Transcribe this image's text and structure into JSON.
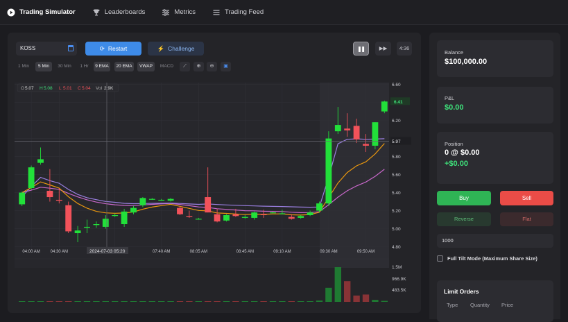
{
  "nav": {
    "items": [
      {
        "label": "Trading Simulator",
        "icon": "play-circle-icon"
      },
      {
        "label": "Leaderboards",
        "icon": "trophy-icon"
      },
      {
        "label": "Metrics",
        "icon": "sliders-icon"
      },
      {
        "label": "Trading Feed",
        "icon": "list-icon"
      }
    ]
  },
  "controls": {
    "ticker": "KOSS",
    "restart_label": "Restart",
    "challenge_label": "Challenge",
    "timer": "4:36",
    "timeframes": [
      "1 Min",
      "5 Min",
      "30 Min",
      "1 Hr"
    ],
    "selected_timeframe": "5 Min",
    "indicators": [
      "9 EMA",
      "20 EMA",
      "VWAP",
      "MACD"
    ],
    "active_indicators": [
      "9 EMA",
      "20 EMA",
      "VWAP"
    ]
  },
  "ohlc": {
    "o_label": "O",
    "o": "5.07",
    "h_label": "H",
    "h": "5.08",
    "l_label": "L",
    "l": "5.01",
    "c_label": "C",
    "c": "5.04",
    "vol_label": "Vol",
    "vol": "2.9K"
  },
  "crosshair": {
    "time_label": "2024-07-03 05:20",
    "price_label": "5.97"
  },
  "last_price": "6.41",
  "colors": {
    "up": "#22e03a",
    "down": "#f2525a",
    "ema9": "#e8960f",
    "ema20": "#c767c9",
    "vwap": "#9a7fe0",
    "accent": "#3e8be8"
  },
  "chart_data": {
    "type": "candlestick",
    "ylim": [
      4.75,
      6.62
    ],
    "y_ticks": [
      "6.60",
      "6.40",
      "6.20",
      "6.00",
      "5.80",
      "5.60",
      "5.40",
      "5.20",
      "5.00",
      "4.80"
    ],
    "x_tick_labels": [
      "04:00 AM",
      "04:30 AM",
      "07:10 AM",
      "07:40 AM",
      "08:05 AM",
      "08:45 AM",
      "09:10 AM",
      "09:30 AM",
      "09:50 AM"
    ],
    "volume_ticks": [
      "1.5M",
      "966.9K",
      "483.5K"
    ],
    "candles": [
      {
        "o": 5.27,
        "h": 5.41,
        "l": 5.25,
        "c": 5.4
      },
      {
        "o": 5.45,
        "h": 5.7,
        "l": 5.43,
        "c": 5.68
      },
      {
        "o": 5.73,
        "h": 5.9,
        "l": 5.71,
        "c": 5.77
      },
      {
        "o": 5.42,
        "h": 5.66,
        "l": 5.3,
        "c": 5.35
      },
      {
        "o": 5.32,
        "h": 5.45,
        "l": 5.28,
        "c": 5.31
      },
      {
        "o": 5.26,
        "h": 5.3,
        "l": 4.95,
        "c": 4.97
      },
      {
        "o": 4.95,
        "h": 5.03,
        "l": 4.85,
        "c": 4.98
      },
      {
        "o": 5.02,
        "h": 5.1,
        "l": 4.95,
        "c": 5.02
      },
      {
        "o": 5.04,
        "h": 5.08,
        "l": 5.01,
        "c": 5.05
      },
      {
        "o": 5.02,
        "h": 5.15,
        "l": 5.0,
        "c": 5.11
      },
      {
        "o": 5.15,
        "h": 5.17,
        "l": 5.13,
        "c": 5.15
      },
      {
        "o": 5.05,
        "h": 5.22,
        "l": 5.02,
        "c": 5.19
      },
      {
        "o": 5.18,
        "h": 5.25,
        "l": 5.16,
        "c": 5.23
      },
      {
        "o": 5.26,
        "h": 5.35,
        "l": 5.24,
        "c": 5.34
      },
      {
        "o": 5.33,
        "h": 5.34,
        "l": 5.32,
        "c": 5.33
      },
      {
        "o": 5.32,
        "h": 5.33,
        "l": 5.31,
        "c": 5.32
      },
      {
        "o": 5.31,
        "h": 5.34,
        "l": 5.3,
        "c": 5.33
      },
      {
        "o": 5.23,
        "h": 5.25,
        "l": 5.15,
        "c": 5.16
      },
      {
        "o": 5.14,
        "h": 5.2,
        "l": 5.12,
        "c": 5.13
      },
      {
        "o": 5.11,
        "h": 5.12,
        "l": 5.1,
        "c": 5.11
      },
      {
        "o": 5.35,
        "h": 5.68,
        "l": 5.18,
        "c": 5.18
      },
      {
        "o": 5.16,
        "h": 5.22,
        "l": 5.07,
        "c": 5.08
      },
      {
        "o": 5.09,
        "h": 5.16,
        "l": 5.08,
        "c": 5.15
      },
      {
        "o": 5.16,
        "h": 5.22,
        "l": 5.13,
        "c": 5.14
      },
      {
        "o": 5.12,
        "h": 5.15,
        "l": 5.11,
        "c": 5.13
      },
      {
        "o": 5.12,
        "h": 5.19,
        "l": 5.1,
        "c": 5.18
      },
      {
        "o": 5.16,
        "h": 5.21,
        "l": 5.12,
        "c": 5.15
      },
      {
        "o": 5.18,
        "h": 5.19,
        "l": 5.17,
        "c": 5.18
      },
      {
        "o": 5.17,
        "h": 5.21,
        "l": 5.16,
        "c": 5.17
      },
      {
        "o": 5.13,
        "h": 5.16,
        "l": 5.1,
        "c": 5.11
      },
      {
        "o": 5.12,
        "h": 5.15,
        "l": 5.11,
        "c": 5.14
      },
      {
        "o": 5.15,
        "h": 5.2,
        "l": 5.14,
        "c": 5.18
      },
      {
        "o": 5.2,
        "h": 5.3,
        "l": 5.18,
        "c": 5.28
      },
      {
        "o": 5.28,
        "h": 6.08,
        "l": 5.25,
        "c": 6.0
      },
      {
        "o": 6.08,
        "h": 6.35,
        "l": 6.05,
        "c": 6.15
      },
      {
        "o": 6.11,
        "h": 6.28,
        "l": 6.02,
        "c": 6.09
      },
      {
        "o": 6.14,
        "h": 6.22,
        "l": 5.95,
        "c": 5.99
      },
      {
        "o": 5.94,
        "h": 6.05,
        "l": 5.85,
        "c": 5.92
      },
      {
        "o": 5.92,
        "h": 6.18,
        "l": 5.88,
        "c": 6.18
      },
      {
        "o": 6.3,
        "h": 6.42,
        "l": 6.28,
        "c": 6.41
      }
    ],
    "volume": [
      6,
      5,
      5,
      6,
      4,
      5,
      4,
      4,
      3,
      4,
      3,
      4,
      3,
      3,
      2,
      2,
      3,
      3,
      3,
      2,
      4,
      3,
      3,
      3,
      3,
      3,
      3,
      3,
      2,
      3,
      3,
      3,
      20,
      210,
      520,
      310,
      95,
      110,
      30,
      15
    ]
  },
  "account": {
    "balance_label": "Balance",
    "balance": "$100,000.00",
    "pnl_label": "P&L",
    "pnl": "$0.00",
    "position_label": "Position",
    "position": "0 @ $0.00",
    "position_pnl": "+$0.00"
  },
  "orders": {
    "buy_label": "Buy",
    "sell_label": "Sell",
    "reverse_label": "Reverse",
    "flat_label": "Flat",
    "quantity": "1000",
    "tilt_label": "Full Tilt Mode (Maximum Share Size)"
  },
  "limit_orders": {
    "title": "Limit Orders",
    "columns": [
      "Type",
      "Quantity",
      "Price"
    ]
  }
}
